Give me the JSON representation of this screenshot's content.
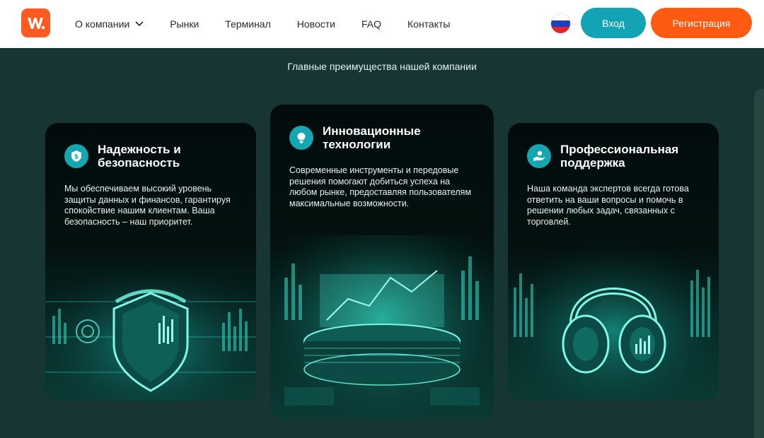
{
  "nav": {
    "about": "О компании",
    "markets": "Рынки",
    "terminal": "Терминал",
    "news": "Новости",
    "faq": "FAQ",
    "contacts": "Контакты"
  },
  "auth": {
    "login": "Вход",
    "register": "Регистрация"
  },
  "section": {
    "subtitle": "Главные преимущества нашей компании"
  },
  "cards": [
    {
      "title": "Надежность и безопасность",
      "text": "Мы обеспечиваем высокий уровень защиты данных и финансов, гарантируя спокойствие нашим клиентам. Ваша безопасность – наш приоритет.",
      "icon": "shield-money-icon"
    },
    {
      "title": "Инновационные технологии",
      "text": "Современные инструменты и передовые решения помогают добиться успеха на любом рынке, предоставляя пользователям максимальные возможности.",
      "icon": "lightbulb-icon"
    },
    {
      "title": "Профессиональная поддержка",
      "text": "Наша команда экспертов всегда готова ответить на ваши вопросы и помочь в решении любых задач, связанных с торговлей.",
      "icon": "support-hand-icon"
    }
  ],
  "colors": {
    "accent_teal": "#12a3b4",
    "accent_orange": "#ff5a12",
    "background": "#173633"
  }
}
